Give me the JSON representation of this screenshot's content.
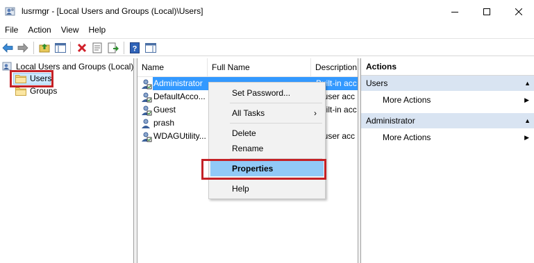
{
  "window": {
    "title": "lusrmgr - [Local Users and Groups (Local)\\Users]",
    "controls": [
      "minimize-icon",
      "maximize-icon",
      "close-icon"
    ]
  },
  "menubar": {
    "items": [
      "File",
      "Action",
      "View",
      "Help"
    ]
  },
  "toolbar": {
    "buttons": [
      "back-arrow-icon",
      "forward-arrow-icon",
      "up-folder-icon",
      "show-hide-tree-icon",
      "delete-icon",
      "properties-icon",
      "export-icon",
      "help-icon",
      "action-pane-icon"
    ]
  },
  "tree": {
    "root": "Local Users and Groups (Local)",
    "children": [
      "Users",
      "Groups"
    ],
    "selected": "Users"
  },
  "list": {
    "columns": [
      "Name",
      "Full Name",
      "Description"
    ],
    "rows": [
      {
        "name": "Administrator",
        "description": "Built-in acc"
      },
      {
        "name": "DefaultAcco...",
        "description": "A user acc"
      },
      {
        "name": "Guest",
        "description": "Built-in acc"
      },
      {
        "name": "prash",
        "description": ""
      },
      {
        "name": "WDAGUtility...",
        "description": "A user acc"
      }
    ],
    "selected_row": "Administrator"
  },
  "context_menu": {
    "items": [
      "Set Password...",
      "All Tasks",
      "Delete",
      "Rename",
      "Properties",
      "Help"
    ],
    "highlighted": "Properties",
    "submenu_indicator": "›"
  },
  "actions": {
    "title": "Actions",
    "groups": [
      {
        "label": "Users",
        "item": "More Actions"
      },
      {
        "label": "Administrator",
        "item": "More Actions"
      }
    ]
  },
  "colors": {
    "selection": "#3399ff",
    "menu_hot": "#91c9f7",
    "callout_box": "#c42126",
    "actions_group_bg": "#d9e4f2"
  }
}
